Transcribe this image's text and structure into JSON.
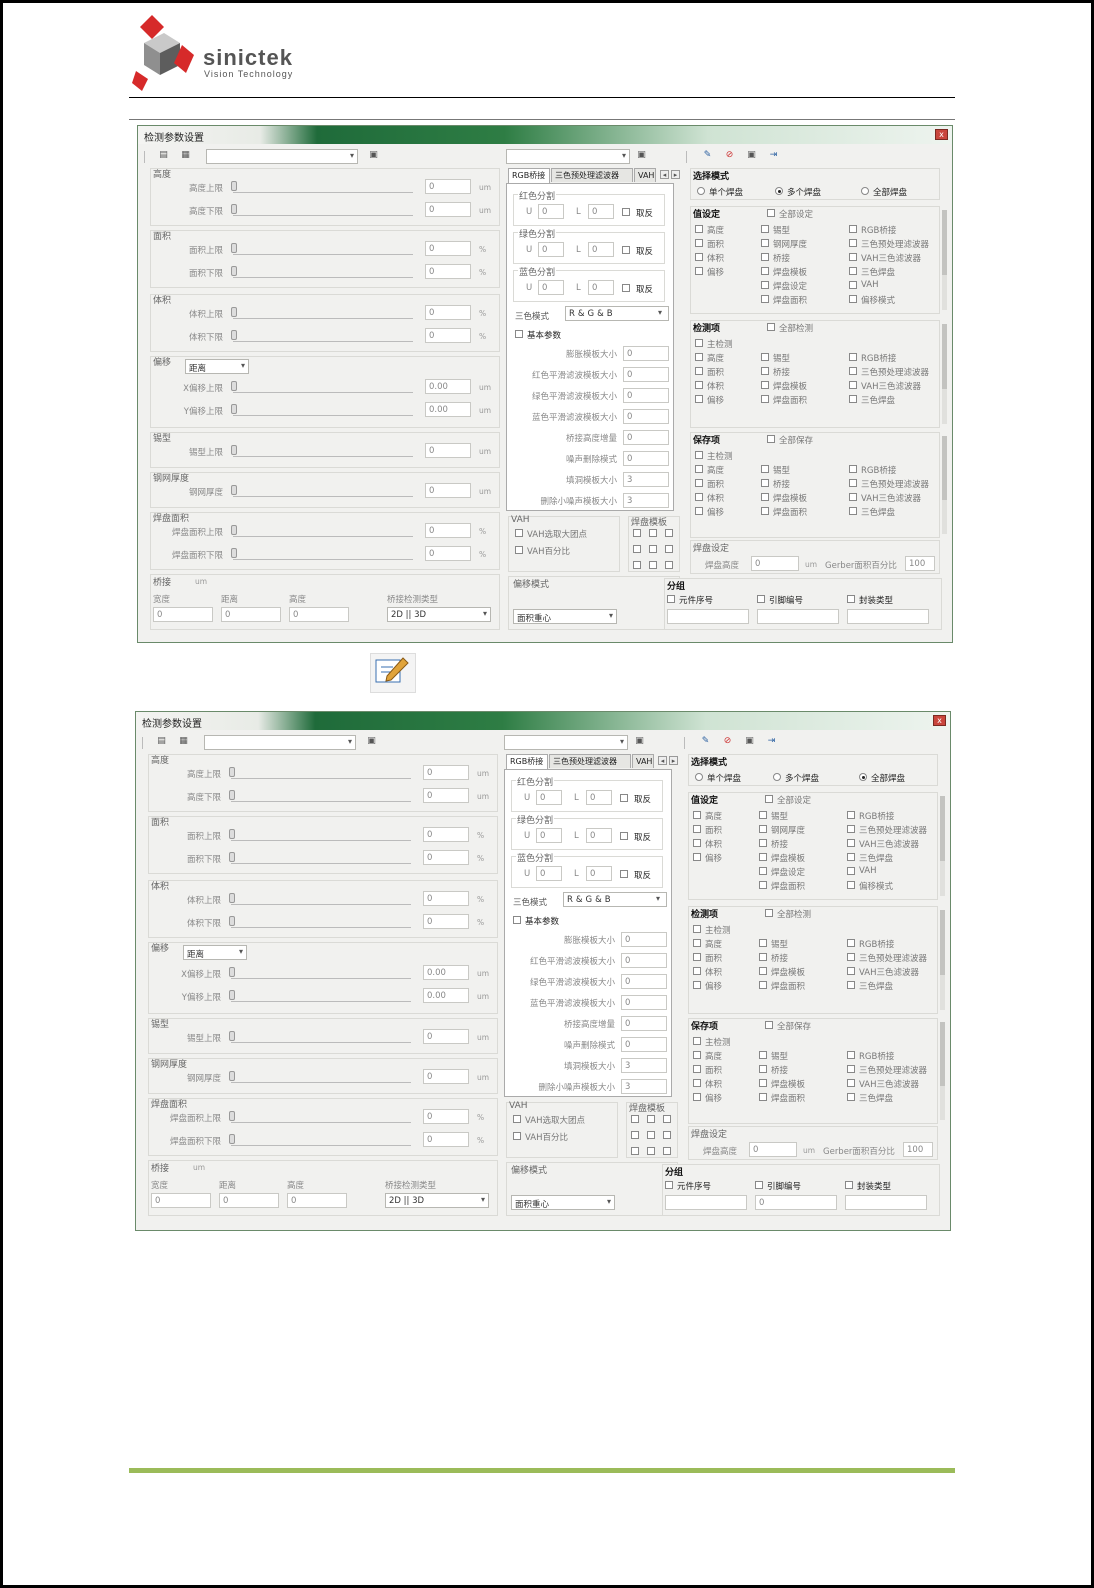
{
  "brand": {
    "name": "sinictek",
    "tagline": "Vision Technology"
  },
  "dialog_title": "检测参数设置",
  "close_glyph": "x",
  "icon_names": [
    "edit-icon",
    "no-icon",
    "save-icon",
    "exit-icon",
    "open-file-icon",
    "save-file-icon",
    "image-icon",
    "separator-icon"
  ],
  "windows": [
    {
      "id": "w1",
      "groups": {
        "height": {
          "title": "高度",
          "rows": [
            {
              "label": "高度上限",
              "value": "0",
              "unit": "um"
            },
            {
              "label": "高度下限",
              "value": "0",
              "unit": "um"
            }
          ]
        },
        "area": {
          "title": "面积",
          "rows": [
            {
              "label": "面积上限",
              "value": "0",
              "unit": "%"
            },
            {
              "label": "面积下限",
              "value": "0",
              "unit": "%"
            }
          ]
        },
        "volume": {
          "title": "体积",
          "rows": [
            {
              "label": "体积上限",
              "value": "0",
              "unit": "%"
            },
            {
              "label": "体积下限",
              "value": "0",
              "unit": "%"
            }
          ]
        },
        "offset": {
          "title": "偏移",
          "select": "距离",
          "rows": [
            {
              "label": "X偏移上限",
              "value": "0.00",
              "unit": "um"
            },
            {
              "label": "Y偏移上限",
              "value": "0.00",
              "unit": "um"
            }
          ]
        },
        "shape": {
          "title": "锡型",
          "rows": [
            {
              "label": "锡型上限",
              "value": "0",
              "unit": "um"
            }
          ]
        },
        "stencil": {
          "title": "钢网厚度",
          "rows": [
            {
              "label": "钢网厚度",
              "value": "0",
              "unit": "um"
            }
          ]
        },
        "pad_area": {
          "title": "焊盘面积",
          "rows": [
            {
              "label": "焊盘面积上限",
              "value": "0",
              "unit": "%"
            },
            {
              "label": "焊盘面积下限",
              "value": "0",
              "unit": "%"
            }
          ]
        }
      },
      "bridge": {
        "title": "桥接",
        "unit": "um",
        "fields": [
          {
            "label": "宽度",
            "value": "0"
          },
          {
            "label": "距离",
            "value": "0"
          },
          {
            "label": "高度",
            "value": "0"
          }
        ],
        "type_label": "桥接检测类型",
        "type_value": "2D || 3D"
      },
      "tabs": [
        "RGB桥接",
        "三色预处理滤波器",
        "VAH三"
      ],
      "color_splits": [
        {
          "title": "红色分割",
          "u": "0",
          "l": "0",
          "invert": "取反"
        },
        {
          "title": "绿色分割",
          "u": "0",
          "l": "0",
          "invert": "取反"
        },
        {
          "title": "蓝色分割",
          "u": "0",
          "l": "0",
          "invert": "取反"
        }
      ],
      "mode_label": "三色模式",
      "mode_value": "R&G&B",
      "basic_params": "基本参数",
      "basic_rows": [
        {
          "label": "膨胀模板大小",
          "value": "0"
        },
        {
          "label": "红色平滑滤波模板大小",
          "value": "0"
        },
        {
          "label": "绿色平滑滤波模板大小",
          "value": "0"
        },
        {
          "label": "蓝色平滑滤波模板大小",
          "value": "0"
        },
        {
          "label": "桥接高度增量",
          "value": "0"
        },
        {
          "label": "噪声删除模式",
          "value": "0"
        },
        {
          "label": "填洞模板大小",
          "value": "3"
        },
        {
          "label": "删除小噪声模板大小",
          "value": "3"
        }
      ],
      "vah": {
        "title": "VAH",
        "items": [
          "VAH选取大团点",
          "VAH百分比"
        ]
      },
      "pad_template": "焊盘模板",
      "offset_mode": {
        "title": "偏移模式",
        "value": "面积重心"
      },
      "select_mode": {
        "title": "选择模式",
        "options": [
          "单个焊盘",
          "多个焊盘",
          "全部焊盘"
        ],
        "selected": 1
      },
      "value_set": {
        "title": "值设定",
        "all": "全部设定",
        "cols": [
          [
            "高度",
            "面积",
            "体积",
            "偏移"
          ],
          [
            "锡型",
            "钢网厚度",
            "桥接",
            "焊盘模板",
            "焊盘设定",
            "焊盘面积"
          ],
          [
            "RGB桥接",
            "三色预处理滤波器",
            "VAH三色滤波器",
            "三色焊盘",
            "VAH",
            "偏移模式"
          ]
        ]
      },
      "check_items": {
        "title": "检测项",
        "all": "全部检测",
        "main": "主检测",
        "cols": [
          [
            "高度",
            "面积",
            "体积",
            "偏移"
          ],
          [
            "锡型",
            "桥接",
            "焊盘模板",
            "焊盘面积"
          ],
          [
            "RGB桥接",
            "三色预处理滤波器",
            "VAH三色滤波器",
            "三色焊盘"
          ]
        ]
      },
      "save_items": {
        "title": "保存项",
        "all": "全部保存",
        "main": "主检测",
        "cols": [
          [
            "高度",
            "面积",
            "体积",
            "偏移"
          ],
          [
            "锡型",
            "桥接",
            "焊盘模板",
            "焊盘面积"
          ],
          [
            "RGB桥接",
            "三色预处理滤波器",
            "VAH三色滤波器",
            "三色焊盘"
          ]
        ]
      },
      "pad_settings": {
        "title": "焊盘设定",
        "height_label": "焊盘高度",
        "height_value": "0",
        "unit": "um",
        "gerber_label": "Gerber面积百分比",
        "gerber_value": "100"
      },
      "grouping": {
        "title": "分组",
        "items": [
          "元件序号",
          "引脚编号",
          "封装类型"
        ],
        "values": [
          "",
          "",
          ""
        ]
      }
    },
    {
      "id": "w2",
      "groups": {
        "height": {
          "title": "高度",
          "rows": [
            {
              "label": "高度上限",
              "value": "0",
              "unit": "um"
            },
            {
              "label": "高度下限",
              "value": "0",
              "unit": "um"
            }
          ]
        },
        "area": {
          "title": "面积",
          "rows": [
            {
              "label": "面积上限",
              "value": "0",
              "unit": "%"
            },
            {
              "label": "面积下限",
              "value": "0",
              "unit": "%"
            }
          ]
        },
        "volume": {
          "title": "体积",
          "rows": [
            {
              "label": "体积上限",
              "value": "0",
              "unit": "%"
            },
            {
              "label": "体积下限",
              "value": "0",
              "unit": "%"
            }
          ]
        },
        "offset": {
          "title": "偏移",
          "select": "距离",
          "rows": [
            {
              "label": "X偏移上限",
              "value": "0.00",
              "unit": "um"
            },
            {
              "label": "Y偏移上限",
              "value": "0.00",
              "unit": "um"
            }
          ]
        },
        "shape": {
          "title": "锡型",
          "rows": [
            {
              "label": "锡型上限",
              "value": "0",
              "unit": "um"
            }
          ]
        },
        "stencil": {
          "title": "钢网厚度",
          "rows": [
            {
              "label": "钢网厚度",
              "value": "0",
              "unit": "um"
            }
          ]
        },
        "pad_area": {
          "title": "焊盘面积",
          "rows": [
            {
              "label": "焊盘面积上限",
              "value": "0",
              "unit": "%"
            },
            {
              "label": "焊盘面积下限",
              "value": "0",
              "unit": "%"
            }
          ]
        }
      },
      "bridge": {
        "title": "桥接",
        "unit": "um",
        "fields": [
          {
            "label": "宽度",
            "value": "0"
          },
          {
            "label": "距离",
            "value": "0"
          },
          {
            "label": "高度",
            "value": "0"
          }
        ],
        "type_label": "桥接检测类型",
        "type_value": "2D || 3D"
      },
      "tabs": [
        "RGB桥接",
        "三色预处理滤波器",
        "VAH三"
      ],
      "color_splits": [
        {
          "title": "红色分割",
          "u": "0",
          "l": "0",
          "invert": "取反"
        },
        {
          "title": "绿色分割",
          "u": "0",
          "l": "0",
          "invert": "取反"
        },
        {
          "title": "蓝色分割",
          "u": "0",
          "l": "0",
          "invert": "取反"
        }
      ],
      "mode_label": "三色模式",
      "mode_value": "R&G&B",
      "basic_params": "基本参数",
      "basic_rows": [
        {
          "label": "膨胀模板大小",
          "value": "0"
        },
        {
          "label": "红色平滑滤波模板大小",
          "value": "0"
        },
        {
          "label": "绿色平滑滤波模板大小",
          "value": "0"
        },
        {
          "label": "蓝色平滑滤波模板大小",
          "value": "0"
        },
        {
          "label": "桥接高度增量",
          "value": "0"
        },
        {
          "label": "噪声删除模式",
          "value": "0"
        },
        {
          "label": "填洞模板大小",
          "value": "3"
        },
        {
          "label": "删除小噪声模板大小",
          "value": "3"
        }
      ],
      "vah": {
        "title": "VAH",
        "items": [
          "VAH选取大团点",
          "VAH百分比"
        ]
      },
      "pad_template": "焊盘模板",
      "offset_mode": {
        "title": "偏移模式",
        "value": "面积重心"
      },
      "select_mode": {
        "title": "选择模式",
        "options": [
          "单个焊盘",
          "多个焊盘",
          "全部焊盘"
        ],
        "selected": 2
      },
      "value_set": {
        "title": "值设定",
        "all": "全部设定",
        "cols": [
          [
            "高度",
            "面积",
            "体积",
            "偏移"
          ],
          [
            "锡型",
            "钢网厚度",
            "桥接",
            "焊盘模板",
            "焊盘设定",
            "焊盘面积"
          ],
          [
            "RGB桥接",
            "三色预处理滤波器",
            "VAH三色滤波器",
            "三色焊盘",
            "VAH",
            "偏移模式"
          ]
        ]
      },
      "check_items": {
        "title": "检测项",
        "all": "全部检测",
        "main": "主检测",
        "cols": [
          [
            "高度",
            "面积",
            "体积",
            "偏移"
          ],
          [
            "锡型",
            "桥接",
            "焊盘模板",
            "焊盘面积"
          ],
          [
            "RGB桥接",
            "三色预处理滤波器",
            "VAH三色滤波器",
            "三色焊盘"
          ]
        ]
      },
      "save_items": {
        "title": "保存项",
        "all": "全部保存",
        "main": "主检测",
        "cols": [
          [
            "高度",
            "面积",
            "体积",
            "偏移"
          ],
          [
            "锡型",
            "桥接",
            "焊盘模板",
            "焊盘面积"
          ],
          [
            "RGB桥接",
            "三色预处理滤波器",
            "VAH三色滤波器",
            "三色焊盘"
          ]
        ]
      },
      "pad_settings": {
        "title": "焊盘设定",
        "height_label": "焊盘高度",
        "height_value": "0",
        "unit": "um",
        "gerber_label": "Gerber面积百分比",
        "gerber_value": "100"
      },
      "grouping": {
        "title": "分组",
        "items": [
          "元件序号",
          "引脚编号",
          "封装类型"
        ],
        "values": [
          "",
          "0",
          ""
        ]
      }
    }
  ]
}
